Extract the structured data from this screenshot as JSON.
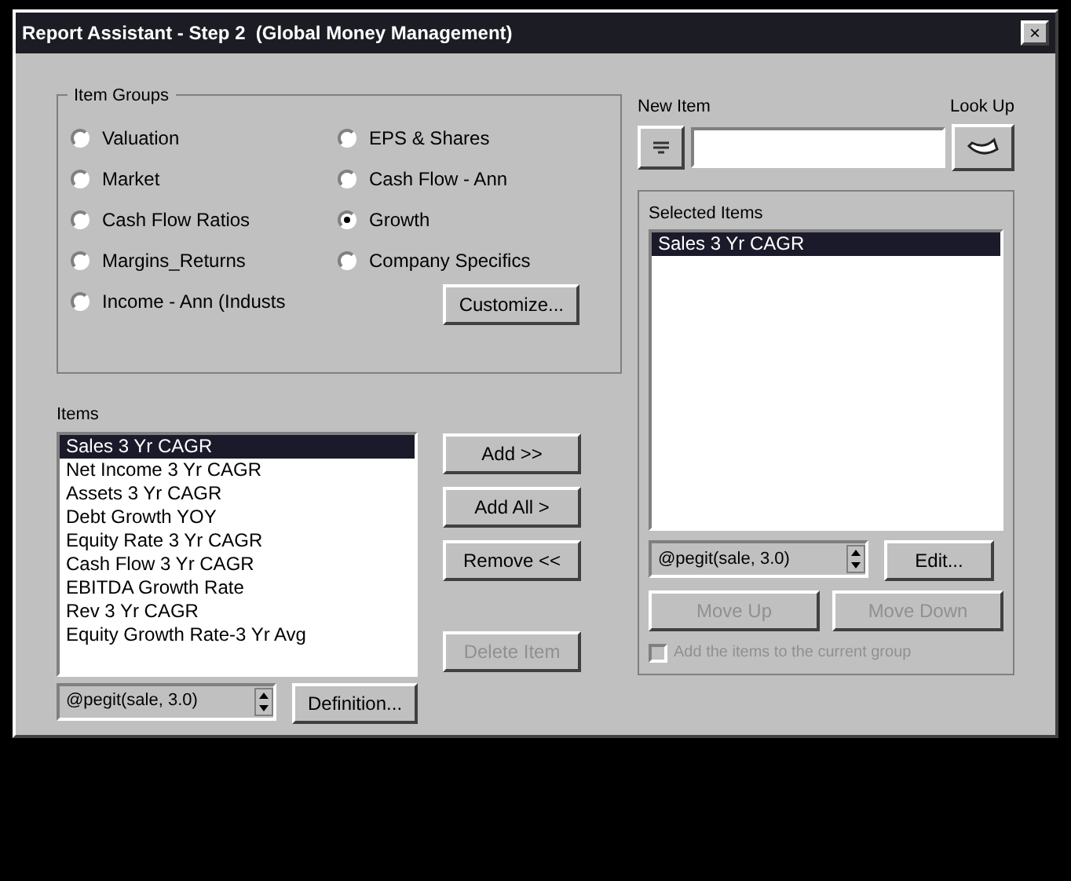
{
  "window": {
    "title": "Report Assistant - Step 2  (Global Money Management)",
    "close": "×"
  },
  "item_groups": {
    "label": "Item Groups",
    "options": [
      {
        "label": "Valuation",
        "selected": false
      },
      {
        "label": "EPS & Shares",
        "selected": false
      },
      {
        "label": "Market",
        "selected": false
      },
      {
        "label": "Cash Flow - Ann",
        "selected": false
      },
      {
        "label": "Cash Flow Ratios",
        "selected": false
      },
      {
        "label": "Growth",
        "selected": true
      },
      {
        "label": "Margins_Returns",
        "selected": false
      },
      {
        "label": "Company Specifics",
        "selected": false
      },
      {
        "label": "Income - Ann (Industs",
        "selected": false
      }
    ],
    "customize": "Customize..."
  },
  "items": {
    "label": "Items",
    "rows": [
      {
        "label": "Sales 3 Yr CAGR",
        "selected": true
      },
      {
        "label": "Net Income 3 Yr CAGR",
        "selected": false
      },
      {
        "label": "Assets 3 Yr CAGR",
        "selected": false
      },
      {
        "label": "Debt Growth YOY",
        "selected": false
      },
      {
        "label": "Equity Rate 3 Yr CAGR",
        "selected": false
      },
      {
        "label": "Cash Flow 3 Yr CAGR",
        "selected": false
      },
      {
        "label": "EBITDA Growth Rate",
        "selected": false
      },
      {
        "label": "Rev 3 Yr CAGR",
        "selected": false
      },
      {
        "label": "Equity Growth Rate-3 Yr Avg",
        "selected": false
      }
    ],
    "formula": "@pegit(sale, 3.0)",
    "definition": "Definition..."
  },
  "middle_buttons": [
    {
      "label": "Add >>",
      "disabled": false
    },
    {
      "label": "Add All >",
      "disabled": false
    },
    {
      "label": "Remove <<",
      "disabled": false
    },
    {
      "label": "Delete Item",
      "disabled": true
    }
  ],
  "new_item": {
    "label": "New Item",
    "lookup": "Look Up"
  },
  "selected_items": {
    "label": "Selected Items",
    "rows": [
      {
        "label": "Sales 3 Yr CAGR",
        "selected": true
      }
    ],
    "formula": "@pegit(sale, 3.0)",
    "edit": "Edit...",
    "buttons": [
      {
        "label": "Move Up",
        "disabled": true
      },
      {
        "label": "Move Down",
        "disabled": true
      }
    ],
    "checkbox": {
      "label": "Add the items to the current group",
      "checked": false,
      "disabled": true
    }
  }
}
